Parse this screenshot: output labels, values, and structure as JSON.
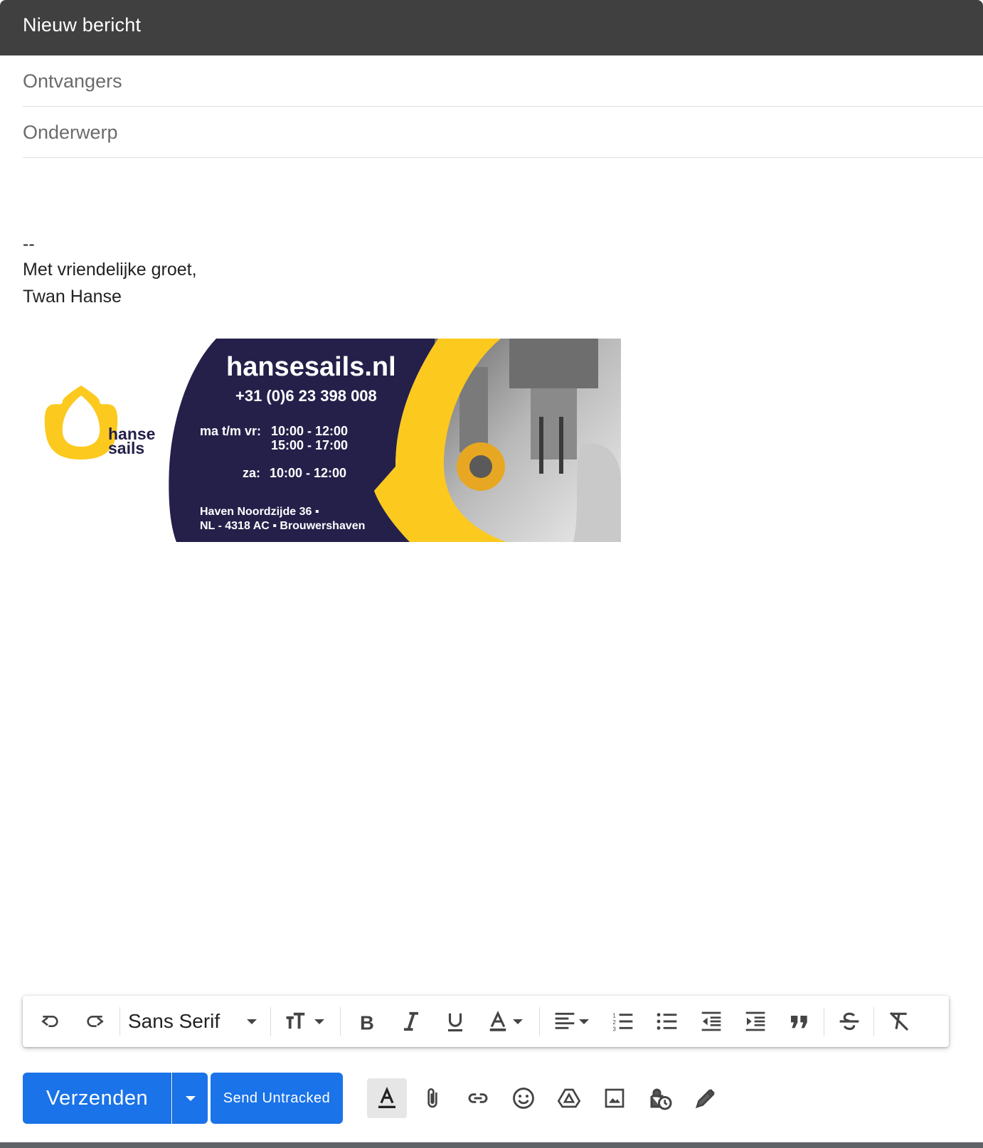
{
  "window": {
    "title": "Nieuw bericht"
  },
  "fields": {
    "to_placeholder": "Ontvangers",
    "subject_placeholder": "Onderwerp"
  },
  "signature": {
    "separator": "--",
    "greeting": "Met vriendelijke groet,",
    "name": "Twan Hanse"
  },
  "banner": {
    "logo_line1": "hanse",
    "logo_line2": "sails",
    "website": "hansesails.nl",
    "phone": "+31 (0)6 23 398 008",
    "hours_weekday_label": "ma t/m vr:",
    "hours_weekday_1": "10:00 - 12:00",
    "hours_weekday_2": "15:00 - 17:00",
    "hours_saturday_label": "za:",
    "hours_saturday": "10:00 - 12:00",
    "address_line1": "Haven Noordzijde 36 ▪",
    "address_line2": "NL - 4318 AC ▪ Brouwershaven",
    "colors": {
      "navy": "#24204a",
      "yellow": "#fcc91f"
    }
  },
  "toolbar": {
    "font_family": "Sans Serif",
    "icons": [
      "undo-icon",
      "redo-icon",
      "font-size-icon",
      "bold-icon",
      "italic-icon",
      "underline-icon",
      "text-color-icon",
      "align-icon",
      "numbered-list-icon",
      "bulleted-list-icon",
      "indent-less-icon",
      "indent-more-icon",
      "quote-icon",
      "strikethrough-icon",
      "clear-formatting-icon"
    ]
  },
  "actions": {
    "send_label": "Verzenden",
    "send_untracked_label": "Send Untracked",
    "icons": [
      "formatting-options-icon",
      "attach-icon",
      "link-icon",
      "emoji-icon",
      "drive-icon",
      "photo-icon",
      "confidential-mode-icon",
      "signature-icon"
    ]
  },
  "colors": {
    "accent": "#1a73e8",
    "titlebar": "#404040"
  }
}
